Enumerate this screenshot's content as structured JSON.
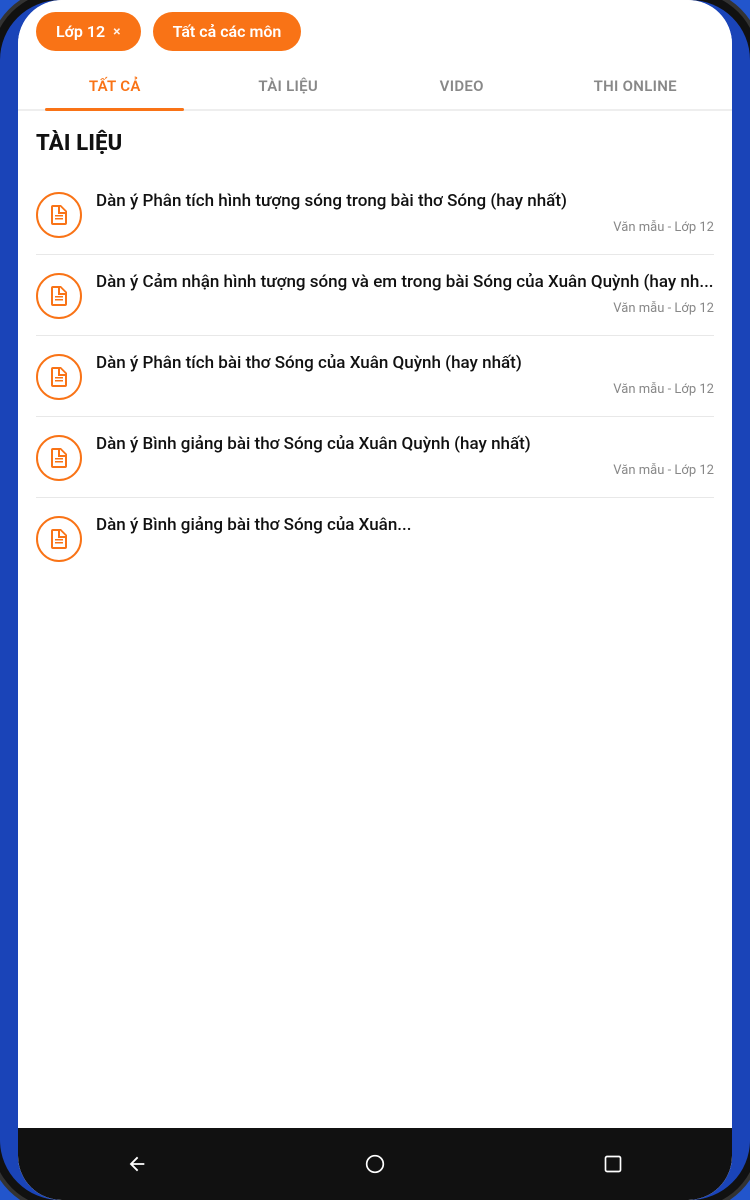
{
  "filters": {
    "chip1_label": "Lớp 12",
    "chip1_close": "×",
    "chip2_label": "Tất cả các môn"
  },
  "tabs": [
    {
      "id": "tat-ca",
      "label": "TẤT CẢ",
      "active": true
    },
    {
      "id": "tai-lieu",
      "label": "TÀI LIỆU",
      "active": false
    },
    {
      "id": "video",
      "label": "VIDEO",
      "active": false
    },
    {
      "id": "thi-online",
      "label": "THI ONLINE",
      "active": false
    }
  ],
  "section": {
    "title": "TÀI LIỆU"
  },
  "items": [
    {
      "title": "Dàn ý Phân tích hình tượng sóng trong bài thơ Sóng  (hay nhất)",
      "meta": "Văn mẫu - Lớp 12"
    },
    {
      "title": "Dàn ý Cảm nhận hình tượng sóng và em trong bài Sóng của Xuân Quỳnh  (hay nh...",
      "meta": "Văn mẫu - Lớp 12"
    },
    {
      "title": "Dàn ý Phân tích bài thơ Sóng của Xuân Quỳnh  (hay nhất)",
      "meta": "Văn mẫu - Lớp 12"
    },
    {
      "title": "Dàn ý Bình giảng bài thơ Sóng của Xuân Quỳnh  (hay nhất)",
      "meta": "Văn mẫu - Lớp 12"
    },
    {
      "title": "Dàn ý Bình giảng bài thơ Sóng của Xuân...",
      "meta": ""
    }
  ],
  "nav": {
    "back_label": "back",
    "home_label": "home",
    "recent_label": "recent"
  }
}
